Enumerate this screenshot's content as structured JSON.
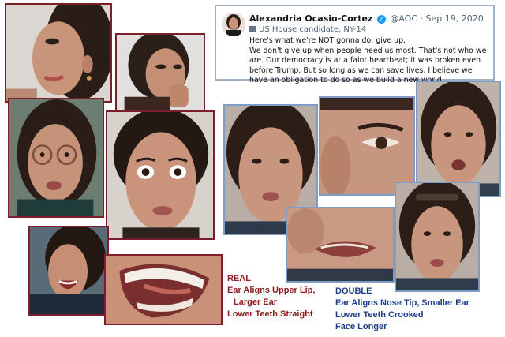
{
  "tweet": {
    "name": "Alexandria Ocasio-Cortez",
    "handle": "@AOC",
    "date": "Sep 19, 2020",
    "label": "US House candidate, NY-14",
    "line1": "Here's what we're NOT gonna do: give up.",
    "line2": "We don't give up when people need us most. That's not who we are. Our democracy is at a faint heartbeat; it was broken even before Trump. But so long as we can save lives, I believe we have an obligation to do so as we build a new world.",
    "verified_color": "#1d9bf0"
  },
  "real_caption": {
    "title": "REAL",
    "line1": "Ear Aligns Upper Lip,",
    "line2": "Larger Ear",
    "line3": "Lower Teeth Straight",
    "color": "#8b1d1d"
  },
  "double_caption": {
    "title": "DOUBLE",
    "line1": "Ear Aligns Nose Tip, Smaller Ear",
    "line2": "Lower Teeth Crooked",
    "line3": "Face Longer",
    "color": "#1f3c88"
  },
  "photos": {
    "real_border": "#7a1f2b",
    "double_border": "#7f9cc4"
  }
}
